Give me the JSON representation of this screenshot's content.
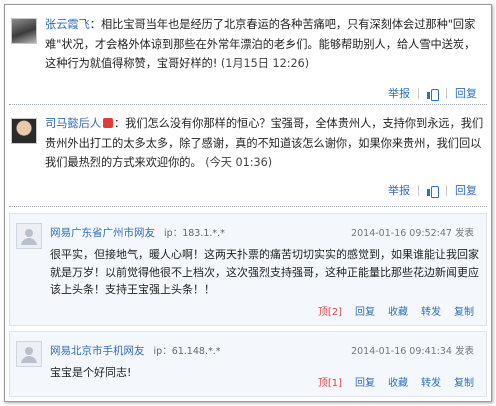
{
  "posts": [
    {
      "user": "张云霞飞",
      "separator": "：",
      "text": "相比宝哥当年也是经历了北京春运的各种苦痛吧，只有深刻体会过那种\"回家难\"状况，才会格外体谅到那些在外常年漂泊的老乡们。能够帮助别人，给人雪中送炭，这种行为就值得称赞，宝哥好样的!",
      "time": "(1月15日 12:26)",
      "actions": {
        "repost": "举报",
        "like_icon": "thumbs-up-icon",
        "reply": "回复"
      }
    },
    {
      "user": "司马懿后人",
      "separator": "：",
      "text": "我们怎么没有你那样的恒心？宝强哥，全体贵州人，支持你到永远，我们贵州外出打工的太多太多，除了感谢，真的不知道该怎么谢你，如果你来贵州，我们回以我们最热烈的方式来欢迎你的。",
      "time": "(今天 01:36)",
      "actions": {
        "repost": "举报",
        "like_icon": "thumbs-up-icon",
        "reply": "回复"
      }
    }
  ],
  "comments": [
    {
      "user": "网易广东省广州市网友",
      "ip": "ip：183.1.*.*",
      "date": "2014-01-16 09:52:47 发表",
      "text": "很平实，但接地气，暖人心啊！这两天扑票的痛苦切切实实的感觉到，如果谁能让我回家就是万岁！以前觉得他很不上档次，这次强烈支持强哥，这种正能量比那些花边新闻更应该上头条！支持王宝强上头条！！",
      "actions": {
        "up": "顶[2]",
        "reply": "回复",
        "favorite": "收藏",
        "share": "转发",
        "copy": "复制"
      }
    },
    {
      "user": "网易北京市手机网友",
      "ip": "ip：61.148.*.*",
      "date": "2014-01-16 09:41:34 发表",
      "text": "宝宝是个好同志!",
      "actions": {
        "up": "顶[1]",
        "reply": "回复",
        "favorite": "收藏",
        "share": "转发",
        "copy": "复制"
      }
    }
  ]
}
